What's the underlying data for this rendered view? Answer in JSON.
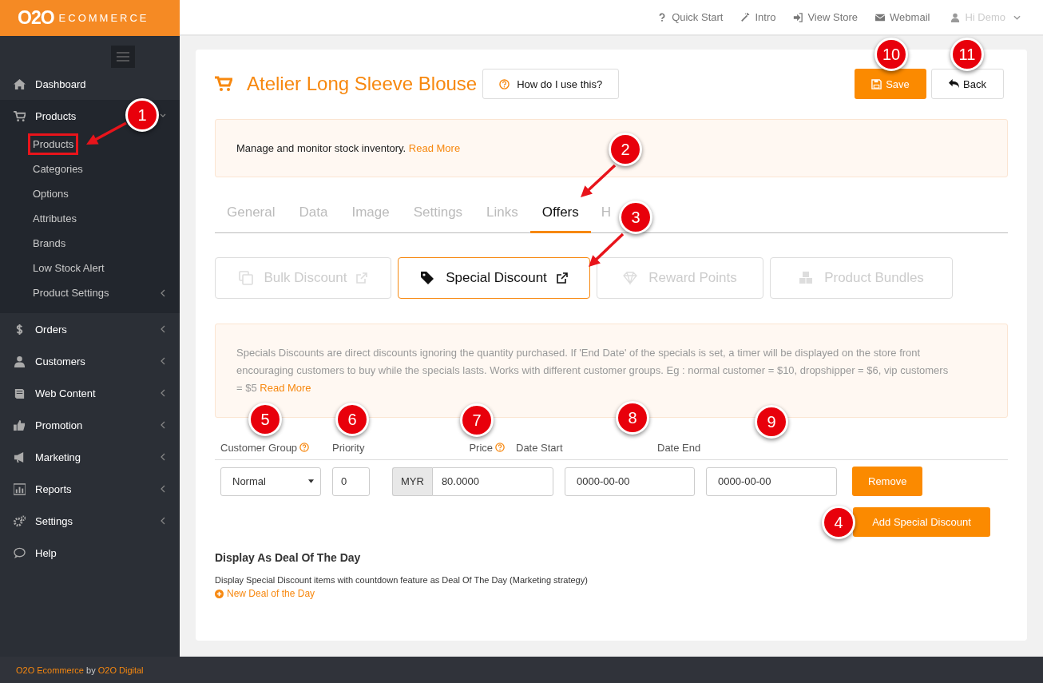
{
  "brand": {
    "logo_mark": "O2O",
    "logo_word": "ECOMMERCE"
  },
  "top_nav": [
    {
      "label": "Quick Start"
    },
    {
      "label": "Intro"
    },
    {
      "label": "View Store"
    },
    {
      "label": "Webmail"
    }
  ],
  "user_menu": {
    "label": "Hi Demo"
  },
  "sidebar": {
    "items": [
      {
        "label": "Dashboard",
        "kind": "link"
      },
      {
        "label": "Products",
        "kind": "group",
        "expanded": true,
        "children": [
          {
            "label": "Products",
            "kind": "link",
            "highlighted": true
          },
          {
            "label": "Categories",
            "kind": "link",
            "highlighted": false
          },
          {
            "label": "Options",
            "kind": "link",
            "highlighted": false
          },
          {
            "label": "Attributes",
            "kind": "link",
            "highlighted": false
          },
          {
            "label": "Brands",
            "kind": "link",
            "highlighted": false
          },
          {
            "label": "Low Stock Alert",
            "kind": "link",
            "highlighted": false
          },
          {
            "label": "Product Settings",
            "kind": "group",
            "highlighted": false
          }
        ]
      },
      {
        "label": "Orders",
        "kind": "group",
        "expanded": false
      },
      {
        "label": "Customers",
        "kind": "group",
        "expanded": false
      },
      {
        "label": "Web Content",
        "kind": "group",
        "expanded": false
      },
      {
        "label": "Promotion",
        "kind": "group",
        "expanded": false
      },
      {
        "label": "Marketing",
        "kind": "group",
        "expanded": false
      },
      {
        "label": "Reports",
        "kind": "group",
        "expanded": false
      },
      {
        "label": "Settings",
        "kind": "group",
        "expanded": false
      },
      {
        "label": "Help",
        "kind": "link"
      }
    ]
  },
  "page": {
    "title": "Atelier Long Sleeve Blouse",
    "help_button": "How do I use this?",
    "save_button": "Save",
    "back_button": "Back"
  },
  "notice": {
    "text": "Manage and monitor stock inventory.",
    "link": "Read More"
  },
  "tabs": [
    {
      "label": "General",
      "selected": false
    },
    {
      "label": "Data",
      "selected": false
    },
    {
      "label": "Image",
      "selected": false
    },
    {
      "label": "Settings",
      "selected": false
    },
    {
      "label": "Links",
      "selected": false
    },
    {
      "label": "Offers",
      "selected": true
    },
    {
      "label": "H",
      "selected": false
    }
  ],
  "offer_types": [
    {
      "label": "Bulk Discount",
      "selected": false
    },
    {
      "label": "Special Discount",
      "selected": true
    },
    {
      "label": "Reward Points",
      "selected": false
    },
    {
      "label": "Product Bundles",
      "selected": false
    }
  ],
  "description": {
    "text": "Specials Discounts are direct discounts ignoring the quantity purchased. If 'End Date' of the specials is set, a timer will be displayed on the store front encouraging customers to buy while the specials lasts. Works with different customer groups. Eg : normal customer = $10, dropshipper = $6, vip customers = $5",
    "link": "Read More"
  },
  "table": {
    "columns": [
      {
        "label": "Customer Group",
        "help": true
      },
      {
        "label": "Priority",
        "help": false
      },
      {
        "label": "Price",
        "help": true
      },
      {
        "label": "Date Start",
        "help": false
      },
      {
        "label": "Date End",
        "help": false
      }
    ],
    "rows": [
      {
        "customer_group": "Normal",
        "priority": "0",
        "currency": "MYR",
        "price": "80.0000",
        "date_start": "0000-00-00",
        "date_end": "0000-00-00",
        "remove": "Remove"
      }
    ],
    "add_button": "Add Special Discount"
  },
  "deal": {
    "heading": "Display As Deal Of The Day",
    "text": "Display Special Discount items with countdown feature as Deal Of The Day (Marketing strategy)",
    "link": "New Deal of the Day"
  },
  "footer": {
    "name": "O2O Ecommerce",
    "by": "by",
    "company": "O2O Digital"
  },
  "callouts": [
    {
      "number": "1"
    },
    {
      "number": "2"
    },
    {
      "number": "3"
    },
    {
      "number": "4"
    },
    {
      "number": "5"
    },
    {
      "number": "6"
    },
    {
      "number": "7"
    },
    {
      "number": "8"
    },
    {
      "number": "9"
    },
    {
      "number": "10"
    },
    {
      "number": "11"
    }
  ]
}
